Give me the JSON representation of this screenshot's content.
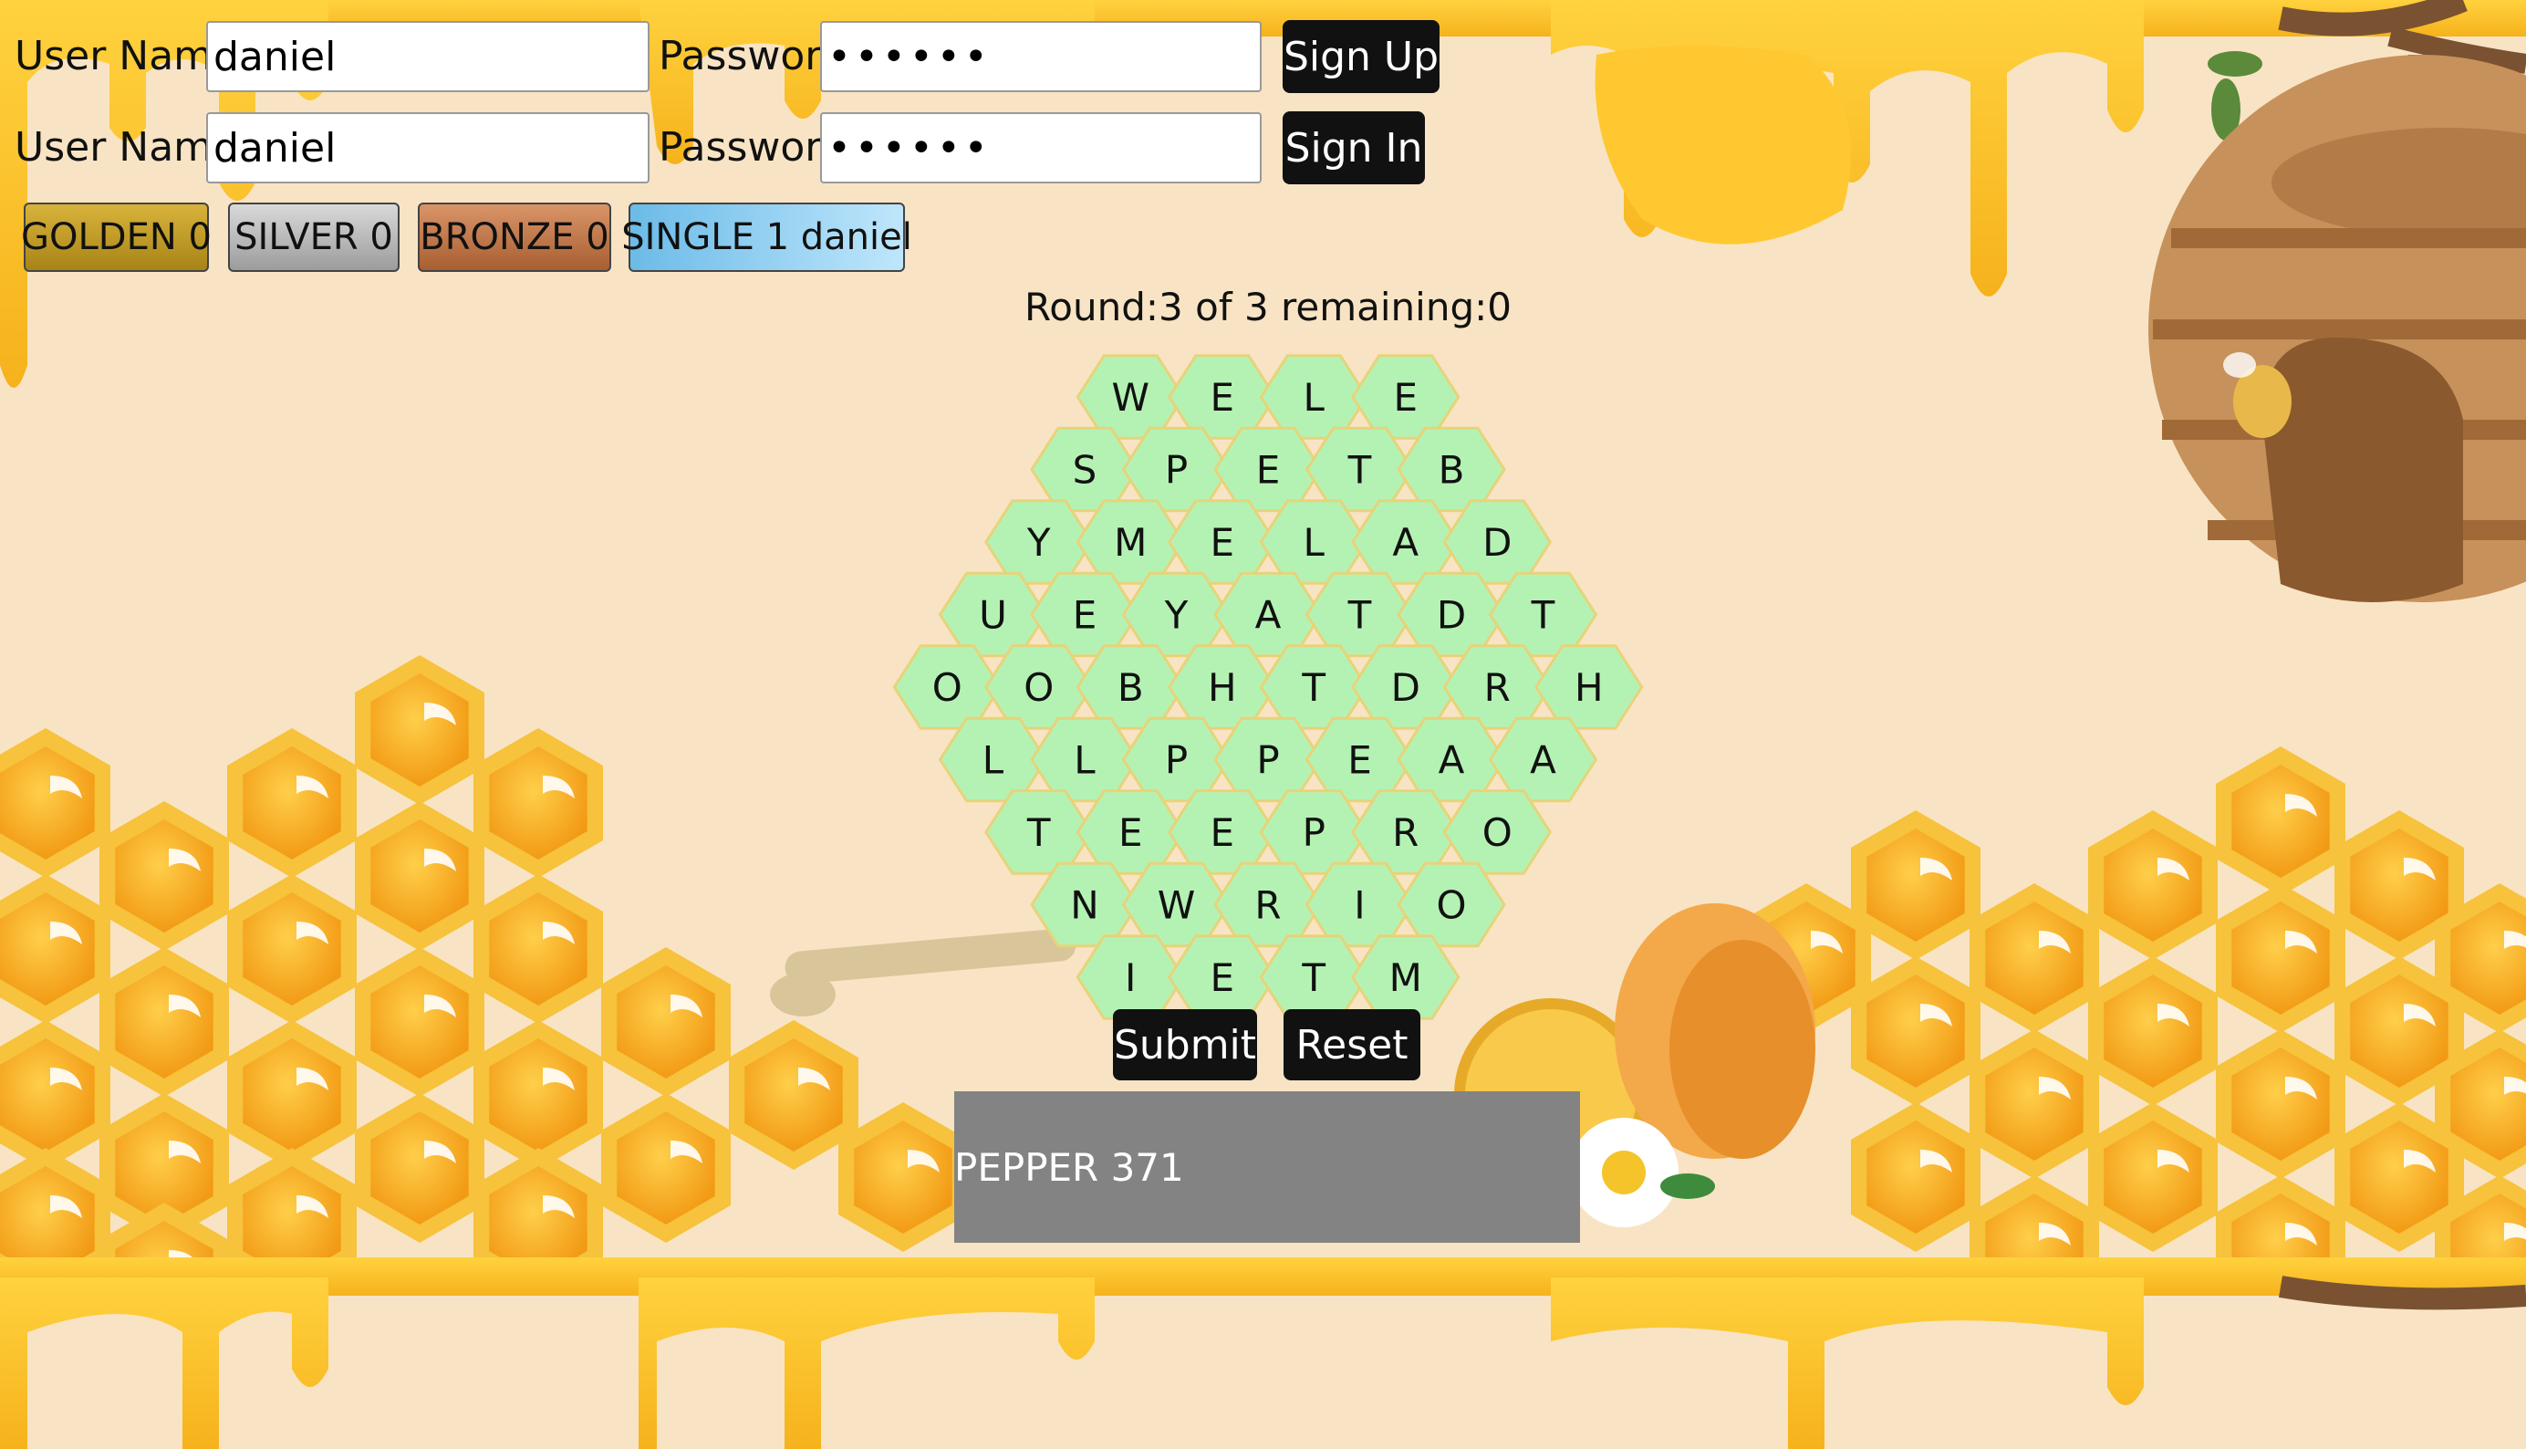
{
  "signup": {
    "username_label": "User Name",
    "username_value": "daniel",
    "password_label": "Password",
    "password_value": "••••••",
    "button_label": "Sign Up"
  },
  "signin": {
    "username_label": "User Name",
    "username_value": "daniel",
    "password_label": "Password",
    "password_value": "••••••",
    "button_label": "Sign In"
  },
  "medals": [
    {
      "label": "GOLDEN 0",
      "color": "#c9a227"
    },
    {
      "label": "SILVER 0",
      "color": "#b3b3b3"
    },
    {
      "label": "BRONZE 0",
      "color": "#c07a4a"
    },
    {
      "label": "SINGLE 1 daniel",
      "color": "#7fc6ee"
    }
  ],
  "round_status": "Round:3 of 3 remaining:0",
  "board": {
    "cell_color": "#b4f2b4",
    "cell_border": "#e7d37a",
    "rows": [
      [
        "W",
        "E",
        "L",
        "E"
      ],
      [
        "S",
        "P",
        "E",
        "T",
        "B"
      ],
      [
        "Y",
        "M",
        "E",
        "L",
        "A",
        "D"
      ],
      [
        "U",
        "E",
        "Y",
        "A",
        "T",
        "D",
        "T"
      ],
      [
        "O",
        "O",
        "B",
        "H",
        "T",
        "D",
        "R",
        "H"
      ],
      [
        "L",
        "L",
        "P",
        "P",
        "E",
        "A",
        "A"
      ],
      [
        "T",
        "E",
        "E",
        "P",
        "R",
        "O"
      ],
      [
        "N",
        "W",
        "R",
        "I",
        "O"
      ],
      [
        "I",
        "E",
        "T",
        "M"
      ]
    ]
  },
  "actions": {
    "submit_label": "Submit",
    "reset_label": "Reset"
  },
  "result_text": "PEPPER 371"
}
